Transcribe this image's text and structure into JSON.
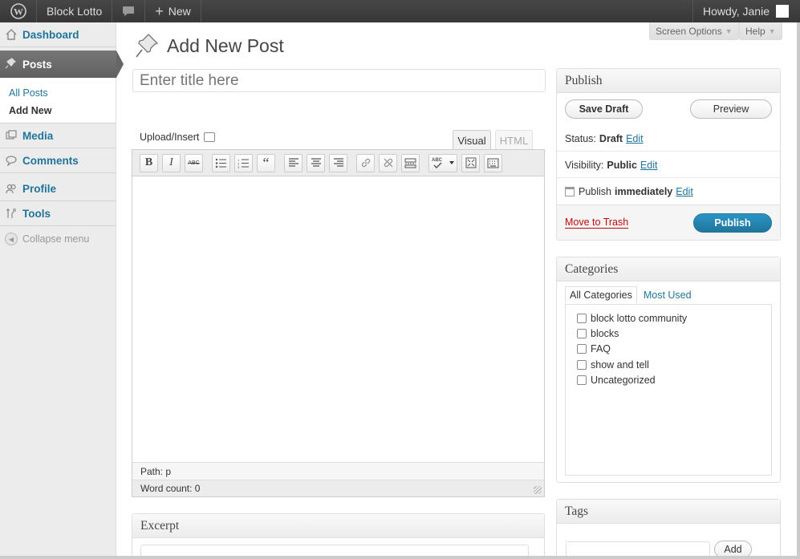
{
  "adminbar": {
    "site_name": "Block Lotto",
    "new_label": "New",
    "howdy": "Howdy, Janie"
  },
  "sidebar": {
    "items": [
      {
        "label": "Dashboard",
        "icon": "home-icon"
      },
      {
        "label": "Posts",
        "icon": "pushpin-icon"
      },
      {
        "label": "Media",
        "icon": "media-icon"
      },
      {
        "label": "Comments",
        "icon": "comment-icon"
      },
      {
        "label": "Profile",
        "icon": "users-icon"
      },
      {
        "label": "Tools",
        "icon": "tools-icon"
      }
    ],
    "submenu": [
      {
        "label": "All Posts"
      },
      {
        "label": "Add New"
      }
    ],
    "collapse": "Collapse menu"
  },
  "screen": {
    "options": "Screen Options",
    "help": "Help"
  },
  "page": {
    "title": "Add New Post",
    "title_placeholder": "Enter title here"
  },
  "editor": {
    "upload": "Upload/Insert",
    "tab_visual": "Visual",
    "tab_html": "HTML",
    "path_label": "Path:",
    "path_value": "p",
    "wordcount": "Word count: 0",
    "toolbar": {
      "bold": "B",
      "italic": "I",
      "strike": "ABC",
      "quote": "“",
      "spell": "ABC"
    }
  },
  "publish": {
    "title": "Publish",
    "save_draft": "Save Draft",
    "preview": "Preview",
    "status_label": "Status:",
    "status_value": "Draft",
    "visibility_label": "Visibility:",
    "visibility_value": "Public",
    "publish_label": "Publish",
    "publish_value": "immediately",
    "edit": "Edit",
    "trash": "Move to Trash",
    "publish_button": "Publish"
  },
  "categories": {
    "title": "Categories",
    "tab_all": "All Categories",
    "tab_used": "Most Used",
    "items": [
      {
        "label": "block lotto community"
      },
      {
        "label": "blocks"
      },
      {
        "label": "FAQ"
      },
      {
        "label": "show and tell"
      },
      {
        "label": "Uncategorized"
      }
    ]
  },
  "tags": {
    "title": "Tags",
    "add": "Add"
  },
  "excerpt": {
    "title": "Excerpt"
  },
  "colors": {
    "link": "#21759b",
    "adminbar": "#464646",
    "trash": "#bc0b0b"
  }
}
